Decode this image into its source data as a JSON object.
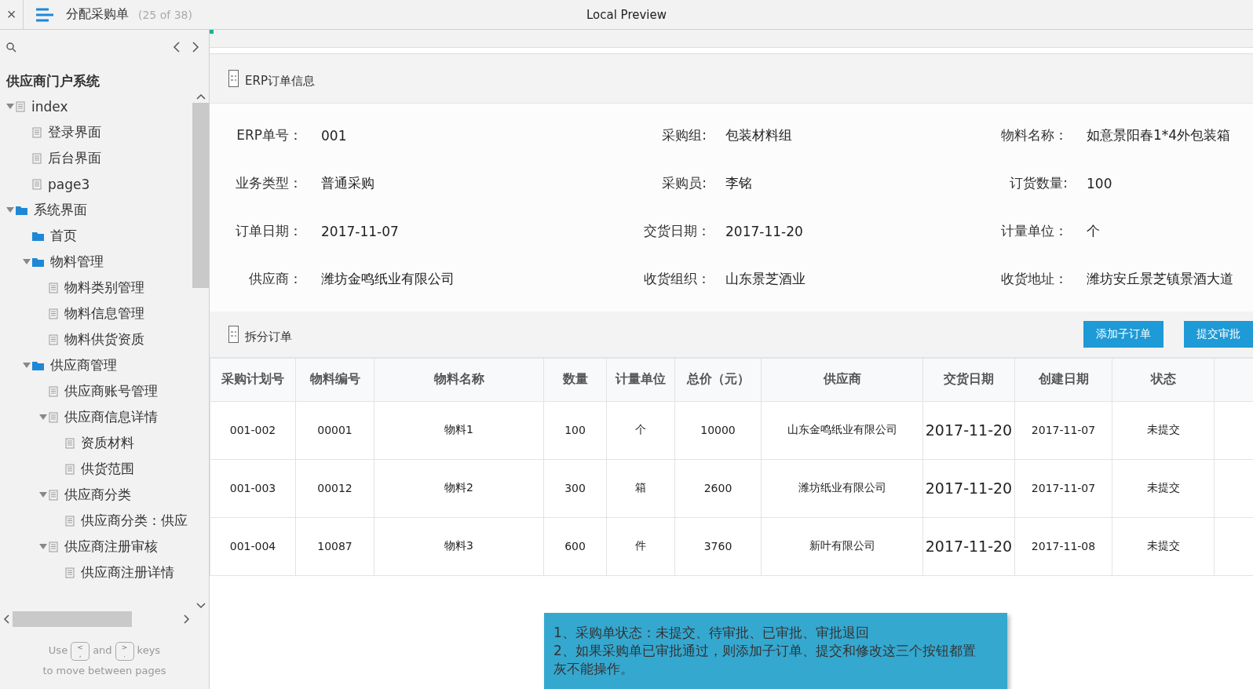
{
  "header": {
    "close": "×",
    "title": "分配采购单",
    "page_count": "(25 of 38)",
    "preview_title": "Local Preview"
  },
  "sidebar": {
    "project_title": "供应商门户系统",
    "tree": [
      {
        "label": "index",
        "kind": "page",
        "expanded": true,
        "children": [
          {
            "label": "登录界面",
            "kind": "page"
          },
          {
            "label": "后台界面",
            "kind": "page"
          },
          {
            "label": "page3",
            "kind": "page"
          }
        ]
      },
      {
        "label": "系统界面",
        "kind": "folder",
        "expanded": true,
        "children": [
          {
            "label": "首页",
            "kind": "folder"
          },
          {
            "label": "物料管理",
            "kind": "folder",
            "expanded": true,
            "children": [
              {
                "label": "物料类别管理",
                "kind": "page"
              },
              {
                "label": "物料信息管理",
                "kind": "page"
              },
              {
                "label": "物料供货资质",
                "kind": "page"
              }
            ]
          },
          {
            "label": "供应商管理",
            "kind": "folder",
            "expanded": true,
            "children": [
              {
                "label": "供应商账号管理",
                "kind": "page"
              },
              {
                "label": "供应商信息详情",
                "kind": "page",
                "expanded": true,
                "children": [
                  {
                    "label": "资质材料",
                    "kind": "page"
                  },
                  {
                    "label": "供货范围",
                    "kind": "page"
                  }
                ]
              },
              {
                "label": "供应商分类",
                "kind": "page",
                "expanded": true,
                "children": [
                  {
                    "label": "供应商分类：供应",
                    "kind": "page"
                  }
                ]
              },
              {
                "label": "供应商注册审核",
                "kind": "page",
                "expanded": true,
                "children": [
                  {
                    "label": "供应商注册详情",
                    "kind": "page"
                  }
                ]
              }
            ]
          }
        ]
      }
    ],
    "hint": {
      "use": "Use",
      "key_prev": [
        "<",
        ","
      ],
      "and": "and",
      "key_next": [
        ">",
        "."
      ],
      "keys": "keys",
      "line2": "to move between pages"
    }
  },
  "erp_panel": {
    "title": "ERP订单信息",
    "fields": [
      {
        "label": "ERP单号：",
        "value": "001"
      },
      {
        "label": "采购组:",
        "value": "包装材料组"
      },
      {
        "label": "物料名称：",
        "value": "如意景阳春1*4外包装箱"
      },
      {
        "label": "业务类型：",
        "value": "普通采购"
      },
      {
        "label": "采购员:",
        "value": "李铭"
      },
      {
        "label": "订货数量:",
        "value": "100"
      },
      {
        "label": "订单日期：",
        "value": "2017-11-07"
      },
      {
        "label": "交货日期：",
        "value": "2017-11-20"
      },
      {
        "label": "计量单位：",
        "value": "个"
      },
      {
        "label": "供应商：",
        "value": "潍坊金鸣纸业有限公司"
      },
      {
        "label": "收货组织：",
        "value": "山东景芝酒业"
      },
      {
        "label": "收货地址：",
        "value": "潍坊安丘景芝镇景酒大道"
      }
    ]
  },
  "split_panel": {
    "title": "拆分订单",
    "buttons": [
      "添加子订单",
      "提交审批"
    ],
    "table": {
      "columns": [
        "采购计划号",
        "物料编号",
        "物料名称",
        "数量",
        "计量单位",
        "总价（元）",
        "供应商",
        "交货日期",
        "创建日期",
        "状态"
      ],
      "rows": [
        [
          "001-002",
          "00001",
          "物料1",
          "100",
          "个",
          "10000",
          "山东金鸣纸业有限公司",
          "2017-11-20",
          "2017-11-07",
          "未提交"
        ],
        [
          "001-003",
          "00012",
          "物料2",
          "300",
          "箱",
          "2600",
          "潍坊纸业有限公司",
          "2017-11-20",
          "2017-11-07",
          "未提交"
        ],
        [
          "001-004",
          "10087",
          "物料3",
          "600",
          "件",
          "3760",
          "新叶有限公司",
          "2017-11-20",
          "2017-11-08",
          "未提交"
        ]
      ]
    }
  },
  "note": [
    "1、采购单状态：未提交、待审批、已审批、审批退回",
    "2、如果采购单已审批通过，则添加子订单、提交和修改这三个按钮都置",
    "灰不能操作。"
  ]
}
